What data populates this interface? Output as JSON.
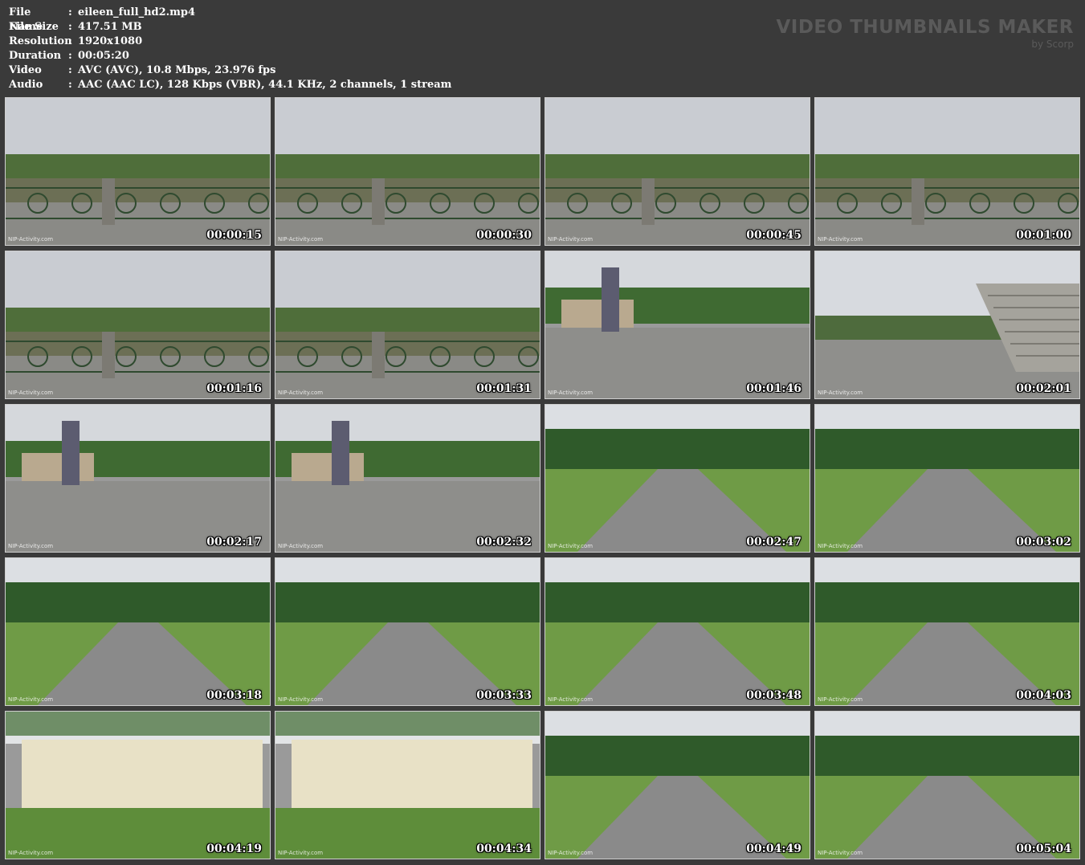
{
  "file_info": [
    {
      "label": "File Name",
      "value": "eileen_full_hd2.mp4"
    },
    {
      "label": "File Size",
      "value": "417.51 MB"
    },
    {
      "label": "Resolution",
      "value": "1920x1080"
    },
    {
      "label": "Duration",
      "value": "00:05:20"
    },
    {
      "label": "Video",
      "value": "AVC (AVC), 10.8 Mbps, 23.976 fps"
    },
    {
      "label": "Audio",
      "value": "AAC (AAC LC), 128 Kbps (VBR), 44.1 KHz, 2 channels, 1 stream"
    }
  ],
  "separator": ":",
  "brand": {
    "title": "VIDEO THUMBNAILS MAKER",
    "subtitle": "by Scorp"
  },
  "watermark": "NIP-Activity.com",
  "thumbnails": [
    {
      "time": "00:00:15",
      "scene": "river-railing"
    },
    {
      "time": "00:00:30",
      "scene": "river-railing"
    },
    {
      "time": "00:00:45",
      "scene": "river-railing"
    },
    {
      "time": "00:01:00",
      "scene": "river-railing"
    },
    {
      "time": "00:01:16",
      "scene": "river-railing"
    },
    {
      "time": "00:01:31",
      "scene": "river-railing"
    },
    {
      "time": "00:01:46",
      "scene": "plaza"
    },
    {
      "time": "00:02:01",
      "scene": "stairs"
    },
    {
      "time": "00:02:17",
      "scene": "plaza"
    },
    {
      "time": "00:02:32",
      "scene": "plaza"
    },
    {
      "time": "00:02:47",
      "scene": "park-path"
    },
    {
      "time": "00:03:02",
      "scene": "park-path"
    },
    {
      "time": "00:03:18",
      "scene": "park-path"
    },
    {
      "time": "00:03:33",
      "scene": "park-path"
    },
    {
      "time": "00:03:48",
      "scene": "park-path"
    },
    {
      "time": "00:04:03",
      "scene": "park-path"
    },
    {
      "time": "00:04:19",
      "scene": "wall-lawn"
    },
    {
      "time": "00:04:34",
      "scene": "wall-lawn"
    },
    {
      "time": "00:04:49",
      "scene": "park-path"
    },
    {
      "time": "00:05:04",
      "scene": "park-path"
    }
  ]
}
